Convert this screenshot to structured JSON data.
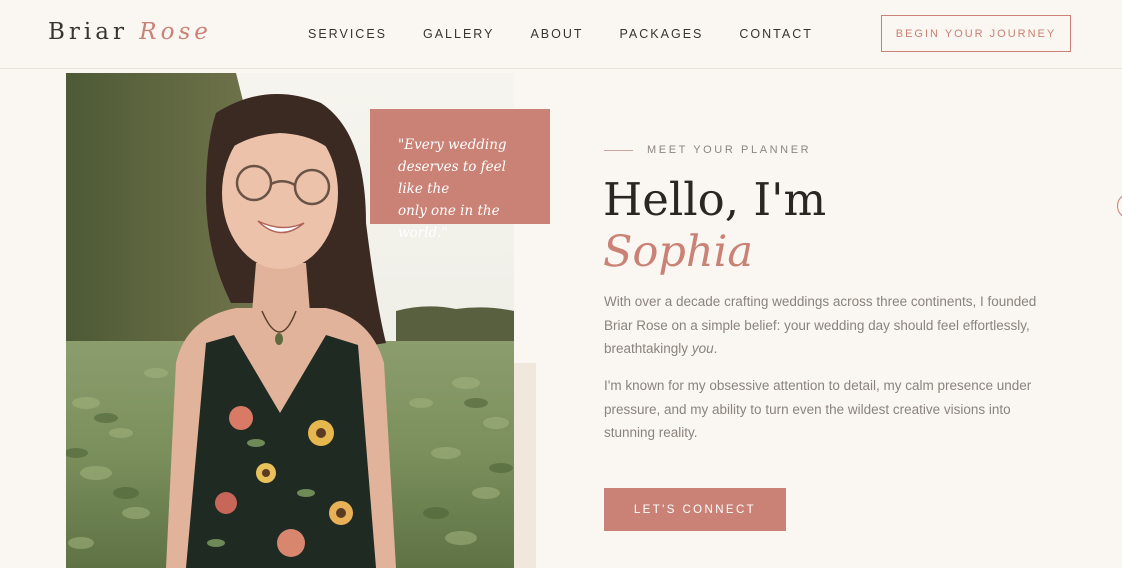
{
  "brand": {
    "first": "Briar",
    "second": "Rose"
  },
  "nav": {
    "items": [
      {
        "label": "SERVICES"
      },
      {
        "label": "GALLERY"
      },
      {
        "label": "ABOUT"
      },
      {
        "label": "PACKAGES"
      },
      {
        "label": "CONTACT"
      }
    ]
  },
  "header": {
    "cta_label": "BEGIN YOUR JOURNEY"
  },
  "photo": {
    "quote_lines": [
      "\"Every wedding",
      "deserves to feel like the",
      "only one in the world.\""
    ]
  },
  "intro": {
    "eyebrow": "MEET YOUR PLANNER",
    "heading": "Hello, I'm",
    "name": "Sophia",
    "para1_main": "With over a decade crafting weddings across three continents, I founded Briar Rose on a simple belief: your wedding day should feel effortlessly, breathtakingly ",
    "para1_em": "you",
    "para1_end": ".",
    "para2": "I'm known for my obsessive attention to detail, my calm presence under pressure, and my ability to turn even the wildest creative visions into stunning reality.",
    "cta_label": "LET'S CONNECT"
  },
  "colors": {
    "accent": "#c98275",
    "background": "#faf6f1",
    "text_dark": "#2a2623",
    "text_muted": "#8b837e"
  },
  "icons": {
    "edge": "circle-outline-icon"
  }
}
